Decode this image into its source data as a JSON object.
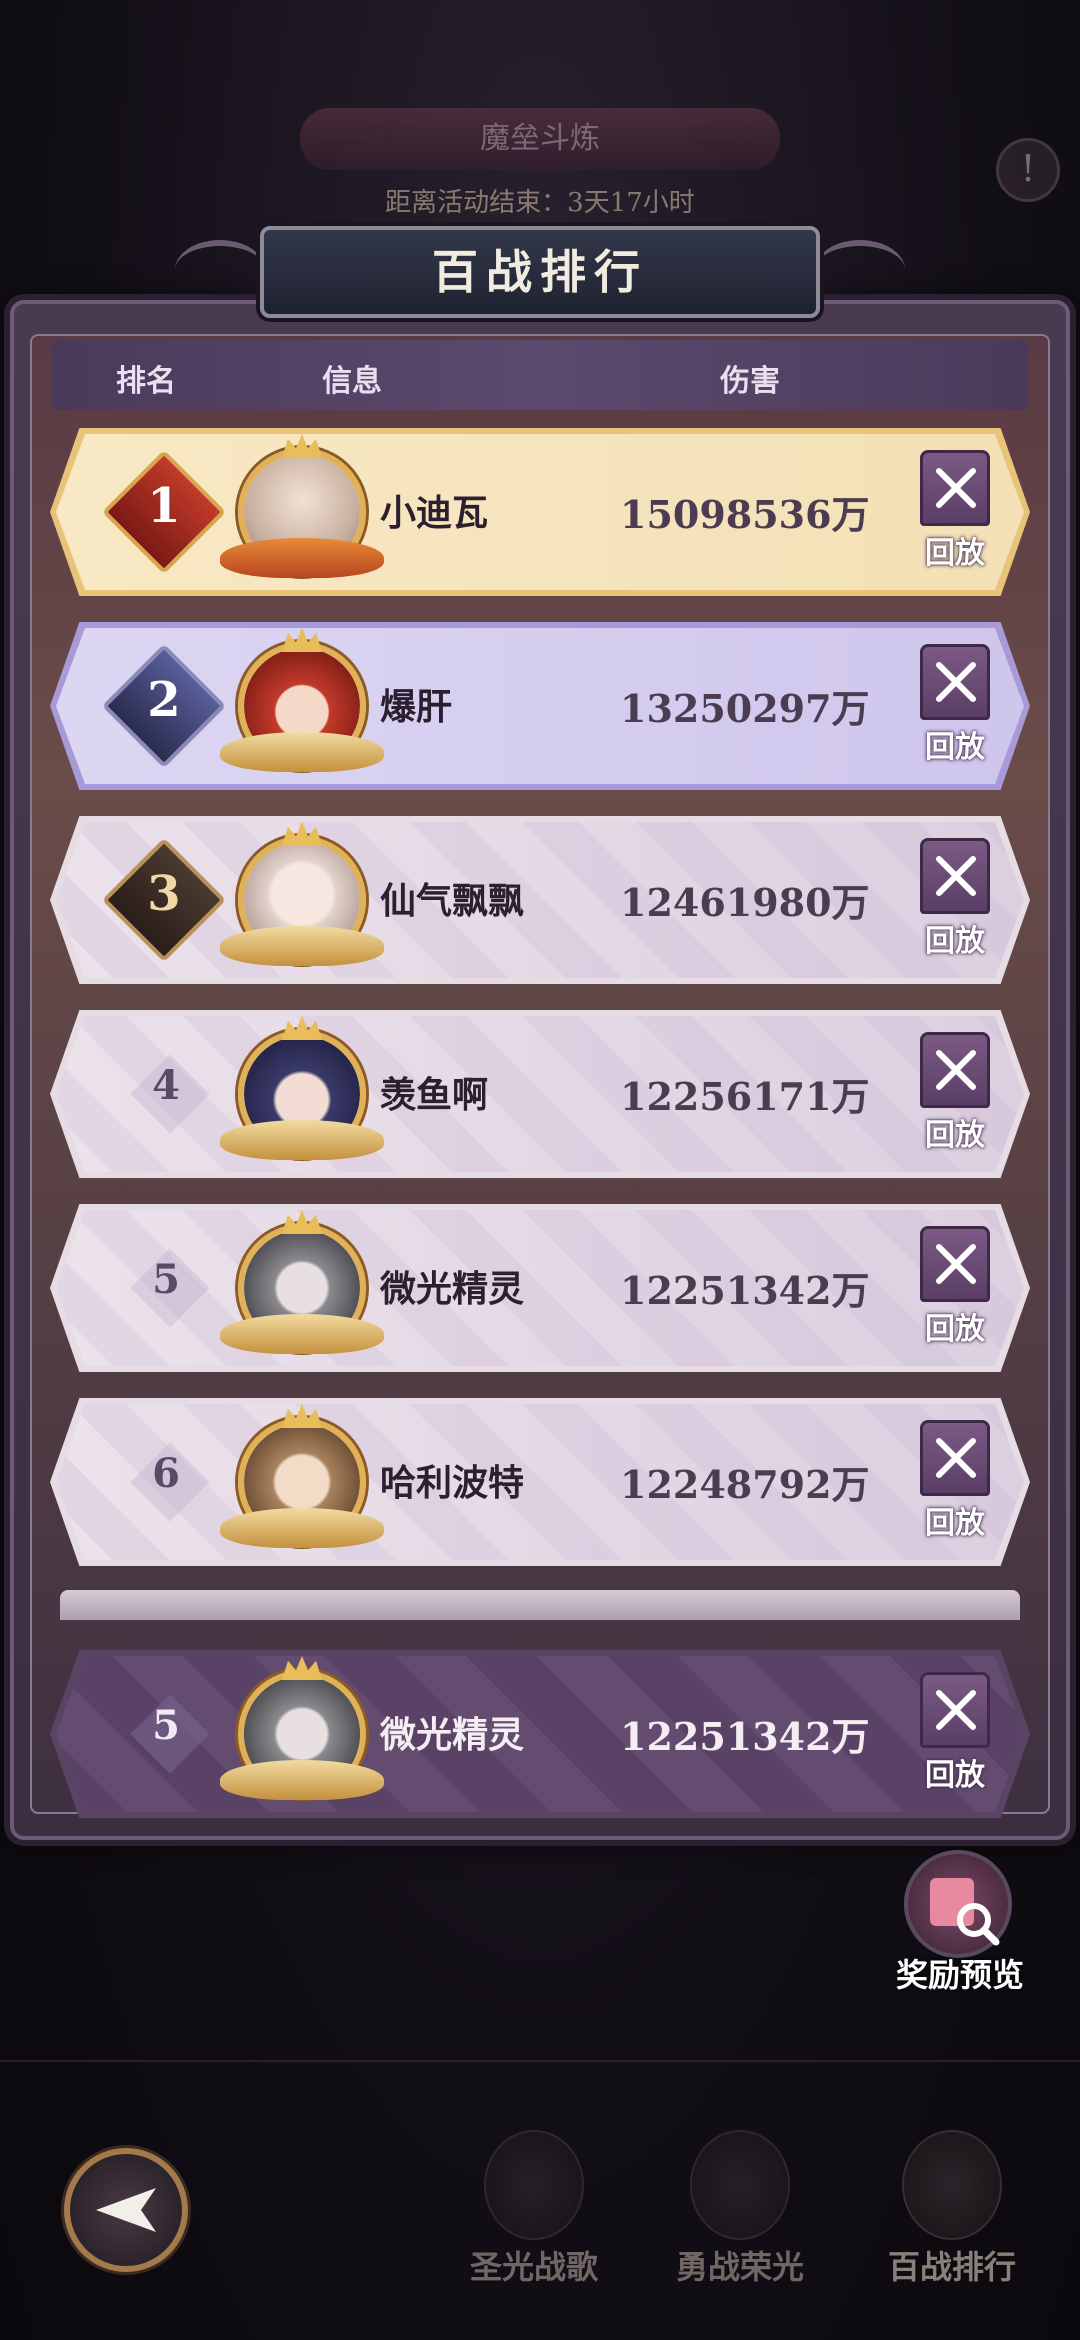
{
  "background": {
    "event_title": "魔垒斗炼",
    "countdown": "距离活动结束：3天17小时"
  },
  "modal": {
    "title": "百战排行",
    "columns": {
      "rank": "排名",
      "info": "信息",
      "damage": "伤害"
    },
    "replay_label": "回放"
  },
  "rows": [
    {
      "rank": "1",
      "name": "小迪瓦",
      "damage": "15098536万"
    },
    {
      "rank": "2",
      "name": "爆肝",
      "damage": "13250297万"
    },
    {
      "rank": "3",
      "name": "仙气飘飘",
      "damage": "12461980万"
    },
    {
      "rank": "4",
      "name": "羡鱼啊",
      "damage": "12256171万"
    },
    {
      "rank": "5",
      "name": "微光精灵",
      "damage": "12251342万"
    },
    {
      "rank": "6",
      "name": "哈利波特",
      "damage": "12248792万"
    }
  ],
  "my_row": {
    "rank": "5",
    "name": "微光精灵",
    "damage": "12251342万"
  },
  "reward_preview": {
    "label": "奖励预览",
    "icon": "reward-search-icon"
  },
  "bottom_tabs": [
    {
      "label": "圣光战歌",
      "icon": "holy-song-icon"
    },
    {
      "label": "勇战荣光",
      "icon": "glory-helmet-icon"
    },
    {
      "label": "百战排行",
      "icon": "ranking-icon"
    }
  ],
  "colors": {
    "gold_row": "#f8e8c4",
    "silver_row": "#dcd6f2",
    "normal_row": "#ece2ea",
    "my_row": "#5a4266"
  }
}
